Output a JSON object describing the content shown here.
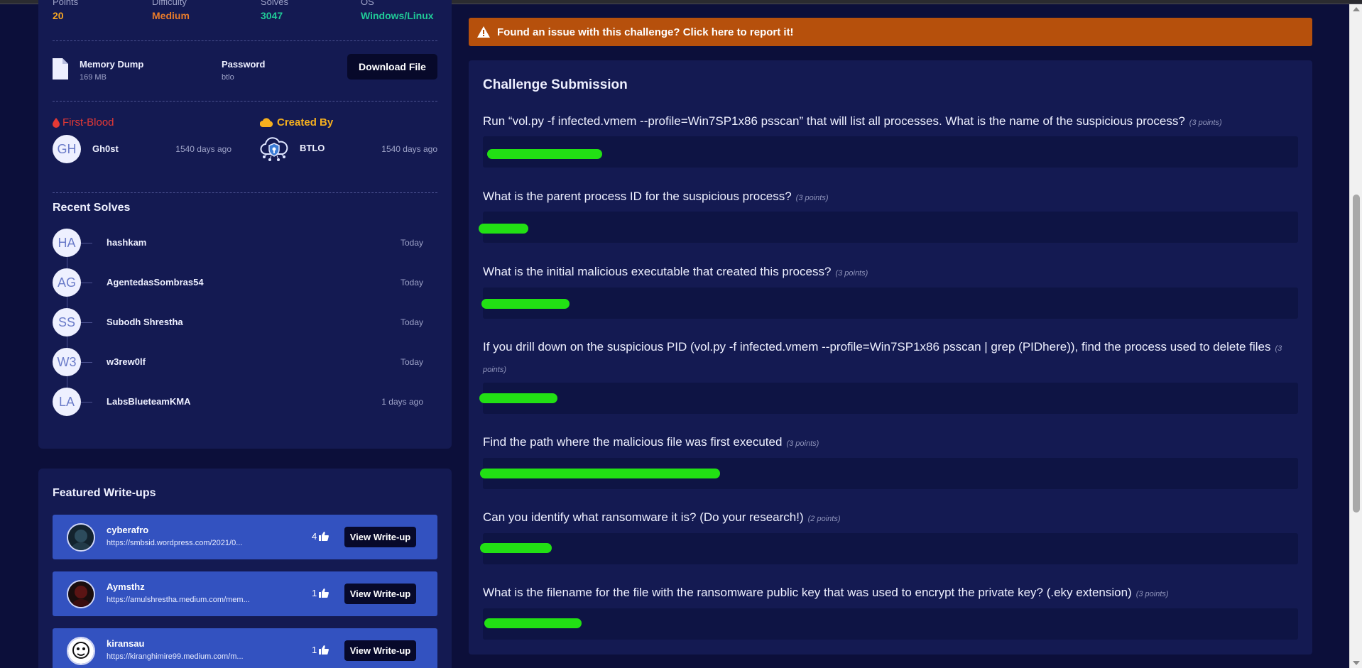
{
  "stats": [
    {
      "label": "Points",
      "value": "20"
    },
    {
      "label": "Difficulty",
      "value": "Medium"
    },
    {
      "label": "Solves",
      "value": "3047"
    },
    {
      "label": "OS",
      "value": "Windows/Linux"
    }
  ],
  "file": {
    "name": "Memory Dump",
    "size": "169 MB",
    "password_label": "Password",
    "password": "btlo",
    "download_label": "Download File"
  },
  "first_blood": {
    "heading": "First-Blood",
    "initials": "GH",
    "user": "Gh0st",
    "time": "1540 days ago"
  },
  "created_by": {
    "heading": "Created By",
    "user": "BTLO",
    "time": "1540 days ago"
  },
  "recent_solves": {
    "title": "Recent Solves",
    "items": [
      {
        "initials": "HA",
        "name": "hashkam",
        "time": "Today"
      },
      {
        "initials": "AG",
        "name": "AgentedasSombras54",
        "time": "Today"
      },
      {
        "initials": "SS",
        "name": "Subodh Shrestha",
        "time": "Today"
      },
      {
        "initials": "W3",
        "name": "w3rew0lf",
        "time": "Today"
      },
      {
        "initials": "LA",
        "name": "LabsBlueteamKMA",
        "time": "1 days ago"
      }
    ]
  },
  "writeups": {
    "title": "Featured Write-ups",
    "button_label": "View Write-up",
    "items": [
      {
        "name": "cyberafro",
        "url": "https://smbsid.wordpress.com/2021/0...",
        "likes": "4"
      },
      {
        "name": "Aymsthz",
        "url": "https://amulshrestha.medium.com/mem...",
        "likes": "1"
      },
      {
        "name": "kiransau",
        "url": "https://kiranghimire99.medium.com/m...",
        "likes": "1"
      }
    ]
  },
  "report": {
    "text": "Found an issue with this challenge? Click here to report it!"
  },
  "submission": {
    "title": "Challenge Submission",
    "questions": [
      {
        "text": "Run “vol.py -f infected.vmem --profile=Win7SP1x86 psscan” that will list all processes. What is the name of the suspicious process?",
        "points": "(3 points)"
      },
      {
        "text": "What is the parent process ID for the suspicious process?",
        "points": "(3 points)"
      },
      {
        "text": "What is the initial malicious executable that created this process?",
        "points": "(3 points)"
      },
      {
        "text": "If you drill down on the suspicious PID (vol.py -f infected.vmem --profile=Win7SP1x86 psscan | grep (PIDhere)), find the process used to delete files",
        "points": "(3 points)"
      },
      {
        "text": "Find the path where the malicious file was first executed",
        "points": "(3 points)"
      },
      {
        "text": "Can you identify what ransomware it is? (Do your research!)",
        "points": "(2 points)"
      },
      {
        "text": "What is the filename for the file with the ransomware public key that was used to encrypt the private key? (.eky extension)",
        "points": "(3 points)"
      }
    ]
  },
  "colors": {
    "accent_orange": "#b6500c",
    "highlight_green": "#22e014",
    "card": "#141a52",
    "background": "#0c0f3a"
  }
}
